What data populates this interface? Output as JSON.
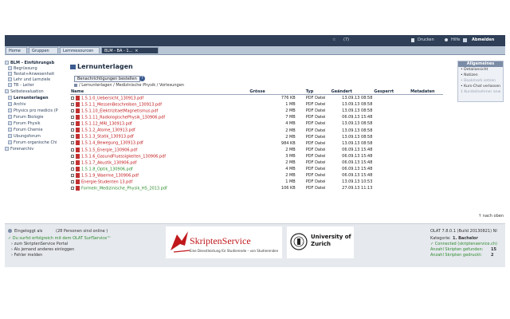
{
  "topbar": {
    "star": "☆",
    "number": "(7)",
    "print": "Drucken",
    "help": "Hilfe",
    "logout": "Abmelden"
  },
  "tabs": [
    {
      "label": "Home"
    },
    {
      "label": "Gruppen"
    },
    {
      "label": "Lernressourcen"
    },
    {
      "label": "BLM - BA - 1..."
    }
  ],
  "nav": [
    {
      "label": "BLM - Einführungsb",
      "bold": true
    },
    {
      "label": "Begrüssung"
    },
    {
      "label": "Testat+Anwesenheit"
    },
    {
      "label": "Lehr und Lernziele"
    },
    {
      "label": "TB - Leiter"
    },
    {
      "label": "Selbstevaluation"
    },
    {
      "label": "Lernunterlagen",
      "bold": true
    },
    {
      "label": "Archiv"
    },
    {
      "label": "Physics pro medicis (P"
    },
    {
      "label": "Forum Biologie"
    },
    {
      "label": "Forum Physik"
    },
    {
      "label": "Forum Chemie"
    },
    {
      "label": "Übungsforum"
    },
    {
      "label": "Forum organische Chi"
    },
    {
      "label": "Forenarchiv"
    }
  ],
  "main": {
    "title": "Lernunterlagen",
    "notify_button": "Benachrichtigungen bestellen",
    "help": "?",
    "breadcrumb": "/ Lernunterlagen / Medizinische Physik / Vorlesungen",
    "columns": {
      "name": "Name",
      "size": "Grösse",
      "type": "Typ",
      "changed": "Geändert",
      "locked": "Gesperrt",
      "metadata": "Metadaten"
    },
    "files": [
      {
        "name": "1.5.1.0_Uebersicht_130913.pdf",
        "size": "776 KB",
        "type": "PDF Datei",
        "date": "13.09.13 08:58",
        "color": "red"
      },
      {
        "name": "1.5.1.1_MessenBeschreiben_130913.pdf",
        "size": "1 MB",
        "type": "PDF Datei",
        "date": "13.09.13 08:58",
        "color": "red"
      },
      {
        "name": "1.5.1.10_ElektrizitaetMagnetismus.pdf",
        "size": "2 MB",
        "type": "PDF Datei",
        "date": "13.09.13 08:58",
        "color": "red"
      },
      {
        "name": "1.5.1.11_RadiologischePhysik_130906.pdf",
        "size": "7 MB",
        "type": "PDF Datei",
        "date": "06.09.13 15:48",
        "color": "red"
      },
      {
        "name": "1.5.1.12_MRI_130913.pdf",
        "size": "4 MB",
        "type": "PDF Datei",
        "date": "13.09.13 08:58",
        "color": "red"
      },
      {
        "name": "1.5.1.2_Atome_130913.pdf",
        "size": "2 MB",
        "type": "PDF Datei",
        "date": "13.09.13 08:58",
        "color": "red"
      },
      {
        "name": "1.5.1.3_Statik_130913.pdf",
        "size": "2 MB",
        "type": "PDF Datei",
        "date": "13.09.13 08:58",
        "color": "red"
      },
      {
        "name": "1.5.1.4_Bewegung_130913.pdf",
        "size": "984 KB",
        "type": "PDF Datei",
        "date": "13.09.13 08:58",
        "color": "red"
      },
      {
        "name": "1.5.1.5_Energie_130906.pdf",
        "size": "2 MB",
        "type": "PDF Datei",
        "date": "06.09.13 15:48",
        "color": "red"
      },
      {
        "name": "1.5.1.6_GasundFluessigkeiten_130906.pdf",
        "size": "3 MB",
        "type": "PDF Datei",
        "date": "06.09.13 15:48",
        "color": "red"
      },
      {
        "name": "1.5.1.7_Akustik_130906.pdf",
        "size": "2 MB",
        "type": "PDF Datei",
        "date": "06.09.13 15:48",
        "color": "red"
      },
      {
        "name": "1.5.1.8_Optik_130906.pdf",
        "size": "4 MB",
        "type": "PDF Datei",
        "date": "06.09.13 15:48",
        "color": "green"
      },
      {
        "name": "1.5.1.9_Waerme_130906.pdf",
        "size": "2 MB",
        "type": "PDF Datei",
        "date": "06.09.13 15:48",
        "color": "red"
      },
      {
        "name": "Energie:Studenten 13.pdf",
        "size": "1 MB",
        "type": "PDF Datei",
        "date": "13.09.13 10:53",
        "color": "red"
      },
      {
        "name": "Formeln_Medizinische_Physik_HS_2013.pdf",
        "size": "106 KB",
        "type": "PDF Datei",
        "date": "27.09.13 11:13",
        "color": "green"
      }
    ],
    "next_top": "nach oben"
  },
  "rightbox": {
    "title": "Allgemeines",
    "items": [
      {
        "label": "Detailansicht",
        "dim": false
      },
      {
        "label": "Notizen",
        "dim": false
      },
      {
        "label": "Bookmark setzen",
        "dim": true
      },
      {
        "label": "Kurs-Chat verlassen",
        "dim": false
      },
      {
        "label": "1 Kursteilnehmer anw",
        "dim": true
      }
    ]
  },
  "footer": {
    "logged_in": "Eingeloggt als",
    "persons": "(28 Personen sind online )",
    "skripten_msg": "Du surfst erfolgreich mit dem OLAT SurfService™",
    "portal": "zum SkriptenService Portal",
    "other_user": "Als jemand anderes einloggen",
    "report": "Fehler melden",
    "version": "OLAT 7.8.0.1 (Build 20130821) NI",
    "category_label": "Kategorie:",
    "category_value": "1. Bachelor",
    "connected": "Connected (skriptenservice.ch)",
    "ordered_label": "Anzahl Skripten gefunden:",
    "ordered_value": "15",
    "printed_label": "Anzahl Skripten gedruckt:",
    "printed_value": "2",
    "skripten_title": "SkriptenService",
    "skripten_sub": "Eine Dienstleistung für Studierende – von Studierenden",
    "uzh_line1": "University of",
    "uzh_line2": "Zurich"
  },
  "colors": {
    "topbar": "#2e3f57",
    "link_red": "#c0181b",
    "link_green": "#2e8b2e"
  }
}
